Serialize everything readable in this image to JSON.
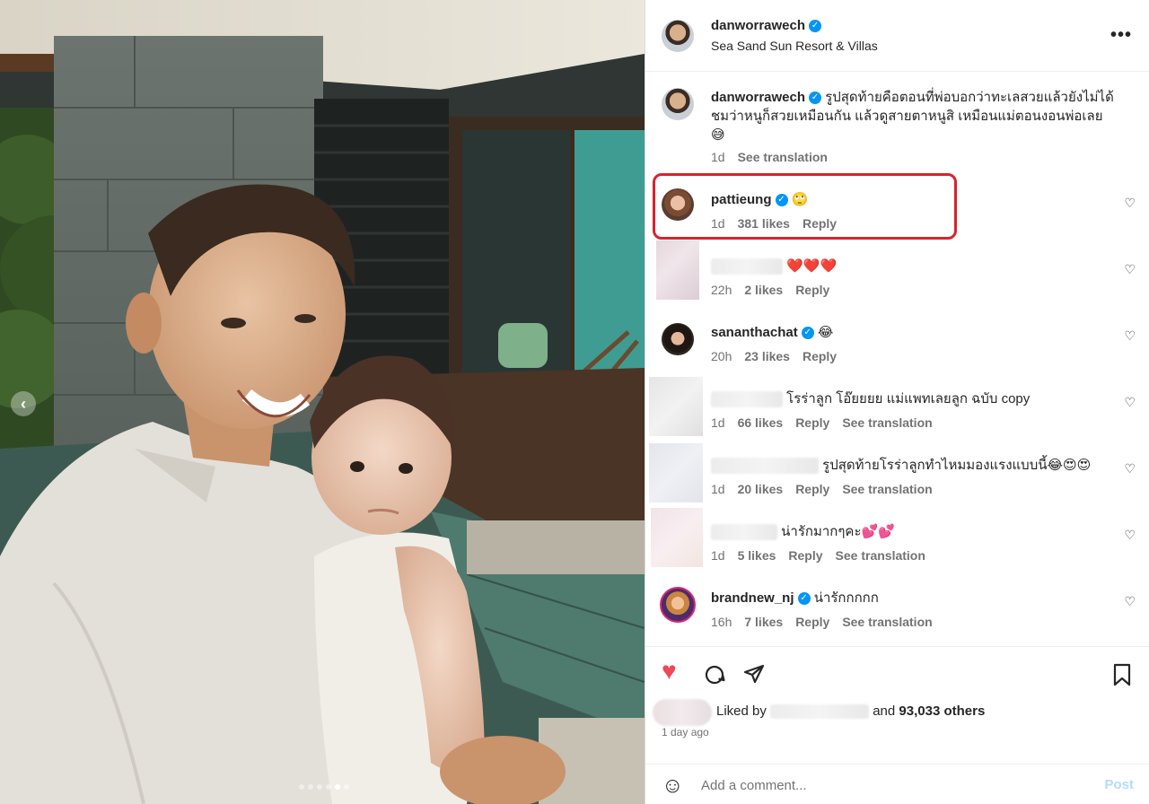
{
  "photo": {
    "prev_icon": "chevron-left-icon",
    "dots_count": 6,
    "active_dot": 4
  },
  "header": {
    "username": "danworrawech",
    "location": "Sea Sand Sun Resort & Villas",
    "more_icon": "more-horizontal-icon"
  },
  "caption": {
    "username": "danworrawech",
    "text": "รูปสุดท้ายคือตอนที่พ่อบอกว่าทะเลสวยแล้วยังไม่ได้ชมว่าหนูก็สวยเหมือนกัน แล้วดูสายตาหนูสิ เหมือนแม่ตอนงอนพ่อเลย😅",
    "time": "1d",
    "see_translation": "See translation"
  },
  "comments": [
    {
      "username": "pattieung",
      "verified": true,
      "text": "🙄",
      "time": "1d",
      "likes": "381 likes",
      "reply": "Reply",
      "translation": ""
    },
    {
      "username": "",
      "verified": false,
      "text": "❤️❤️❤️",
      "time": "22h",
      "likes": "2 likes",
      "reply": "Reply",
      "translation": ""
    },
    {
      "username": "sananthachat",
      "verified": true,
      "text": "😂",
      "time": "20h",
      "likes": "23 likes",
      "reply": "Reply",
      "translation": ""
    },
    {
      "username": "",
      "verified": false,
      "text": "โรร่าลูก โอ๊ยยยย แม่แพทเลยลูก ฉบับ copy",
      "time": "1d",
      "likes": "66 likes",
      "reply": "Reply",
      "translation": "See translation"
    },
    {
      "username": "",
      "verified": false,
      "text": "รูปสุดท้ายโรร่าลูกทำไหมมองแรงแบบนี้😂😍😍",
      "time": "1d",
      "likes": "20 likes",
      "reply": "Reply",
      "translation": "See translation"
    },
    {
      "username": "",
      "verified": false,
      "text": "น่ารักมากๆคะ💕💕",
      "time": "1d",
      "likes": "5 likes",
      "reply": "Reply",
      "translation": "See translation"
    },
    {
      "username": "brandnew_nj",
      "verified": true,
      "text": "น่ารักกกกก",
      "time": "16h",
      "likes": "7 likes",
      "reply": "Reply",
      "translation": "See translation"
    }
  ],
  "actions": {
    "like_icon": "heart-filled-icon",
    "comment_icon": "comment-icon",
    "share_icon": "send-icon",
    "save_icon": "bookmark-icon",
    "liked_by_prefix": "Liked by",
    "liked_by_and": "and",
    "others": "93,033 others",
    "time_ago": "1 day ago"
  },
  "add_comment": {
    "emoji_icon": "smiley-icon",
    "placeholder": "Add a comment...",
    "post_label": "Post"
  },
  "colors": {
    "verified": "#0095f6",
    "like_red": "#ed4956",
    "highlight_red": "#d8232a",
    "post_disabled": "#b3dbff",
    "meta_gray": "#737373"
  }
}
